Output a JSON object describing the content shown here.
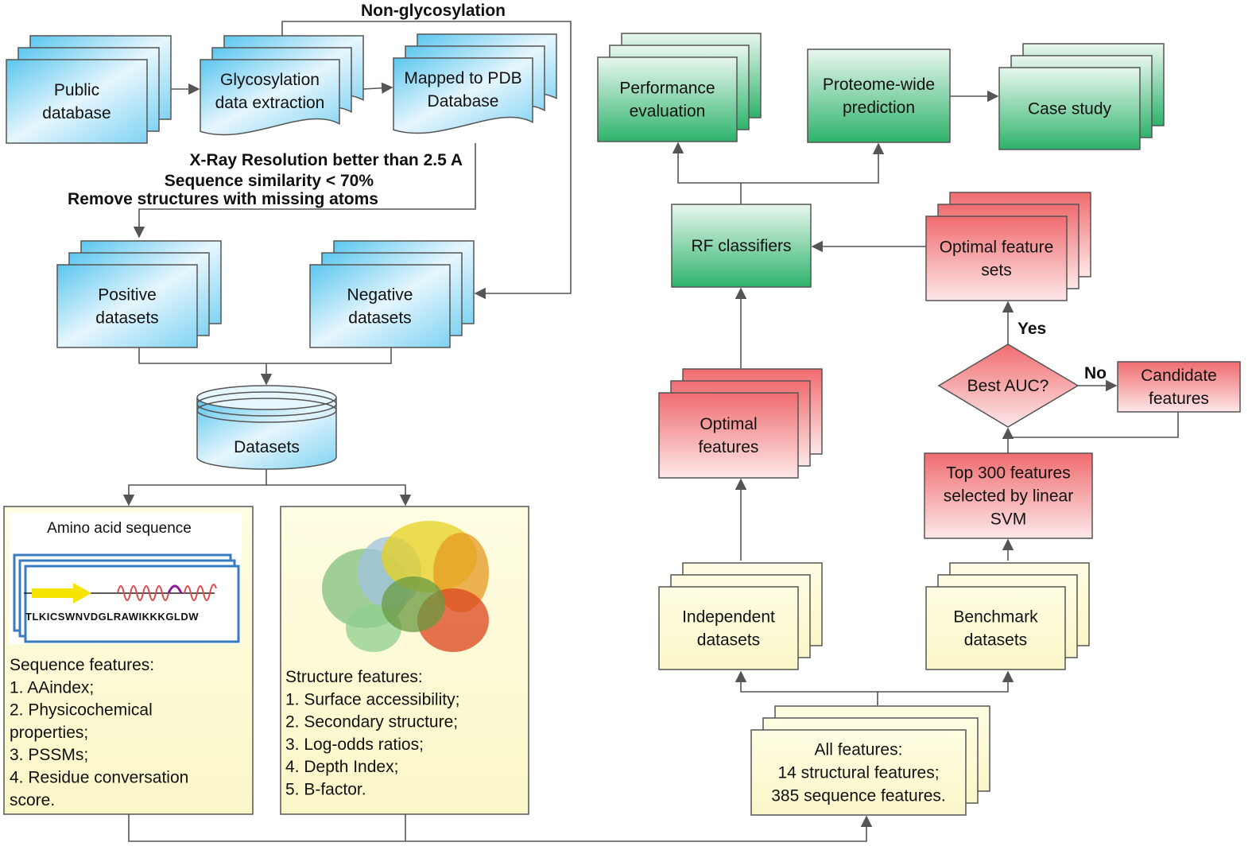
{
  "colors": {
    "blue": "#5cc6ef",
    "blue_light": "#e6f6fd",
    "green": "#2eb36b",
    "green_light": "#e8f7ee",
    "red": "#f06c70",
    "red_light": "#fde8e8",
    "yellow": "#fffde3",
    "stroke": "#555555"
  },
  "labels": {
    "non_glycosylation": "Non-glycosylation",
    "criteria": [
      "X-Ray Resolution better than 2.5 A",
      "Sequence similarity < 70%",
      "Remove structures with missing atoms"
    ],
    "yes": "Yes",
    "no": "No"
  },
  "nodes": {
    "public_db": [
      "Public",
      "database"
    ],
    "glyco": [
      "Glycosylation",
      "data extraction"
    ],
    "mapped": [
      "Mapped to PDB",
      "Database"
    ],
    "positive": [
      "Positive",
      "datasets"
    ],
    "negative": [
      "Negative",
      "datasets"
    ],
    "datasets": [
      "Datasets"
    ],
    "perf": [
      "Performance",
      "evaluation"
    ],
    "proteome": [
      "Proteome-wide",
      "prediction"
    ],
    "case": [
      "Case study"
    ],
    "rf": [
      "RF classifiers"
    ],
    "optfs": [
      "Optimal feature",
      "sets"
    ],
    "bestauc": [
      "Best AUC?"
    ],
    "candidate": [
      "Candidate",
      "features"
    ],
    "top300": [
      "Top 300 features",
      "selected by linear",
      "SVM"
    ],
    "optfeat": [
      "Optimal",
      "features"
    ],
    "indep": [
      "Independent",
      "datasets"
    ],
    "bench": [
      "Benchmark",
      "datasets"
    ],
    "allfeat": [
      "All features:",
      "14 structural features;",
      "385 sequence features."
    ]
  },
  "sequence_panel": {
    "title": "Amino acid sequence",
    "sequence": "TLKICSWNVDGLRAWIKKKGLDW",
    "features": [
      "Sequence features:",
      "1. AAindex;",
      "2. Physicochemical",
      "properties;",
      "3. PSSMs;",
      "4. Residue conversation",
      "score."
    ]
  },
  "structure_panel": {
    "features": [
      "Structure features:",
      "1. Surface accessibility;",
      "2. Secondary structure;",
      "3. Log-odds ratios;",
      "4. Depth Index;",
      "5. B-factor."
    ]
  }
}
